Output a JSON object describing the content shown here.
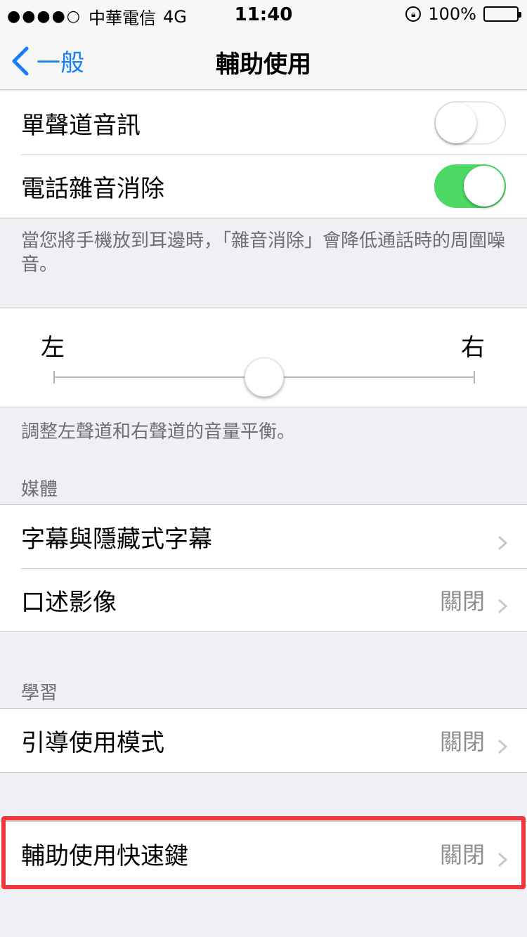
{
  "status_bar": {
    "carrier": "中華電信",
    "network": "4G",
    "time": "11:40",
    "battery": "100%"
  },
  "nav": {
    "back_label": "一般",
    "title": "輔助使用"
  },
  "audio": {
    "mono_audio": {
      "label": "單聲道音訊",
      "on": false
    },
    "noise_cancel": {
      "label": "電話雜音消除",
      "on": true
    },
    "noise_footnote": "當您將手機放到耳邊時，「雜音消除」會降低通話時的周圍噪音。"
  },
  "balance": {
    "left_label": "左",
    "right_label": "右",
    "value": 0.5,
    "footnote": "調整左聲道和右聲道的音量平衡。"
  },
  "media": {
    "header": "媒體",
    "items": [
      {
        "label": "字幕與隱藏式字幕",
        "value": ""
      },
      {
        "label": "口述影像",
        "value": "關閉"
      }
    ]
  },
  "learning": {
    "header": "學習",
    "items": [
      {
        "label": "引導使用模式",
        "value": "關閉"
      }
    ]
  },
  "shortcut": {
    "label": "輔助使用快速鍵",
    "value": "關閉"
  },
  "colors": {
    "ios_blue": "#157efb",
    "toggle_green": "#4cd964",
    "highlight_red": "#f0373b"
  }
}
